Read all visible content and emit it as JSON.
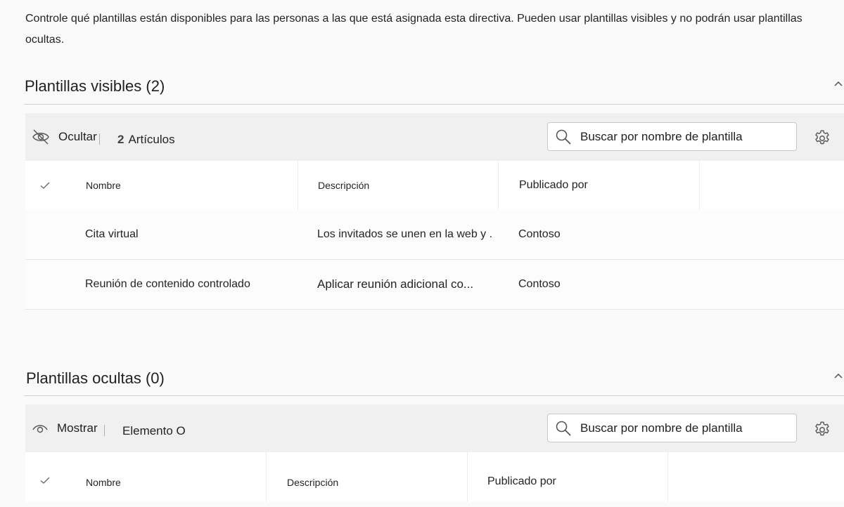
{
  "intro_text": "Controle qué plantillas están disponibles para las personas a las que está asignada esta directiva. Pueden usar plantillas visibles y no podrán usar plantillas ocultas.",
  "visible_section": {
    "title": "Plantillas visibles (2)",
    "action_label": "Ocultar",
    "count_number": "2",
    "count_label": "Artículos",
    "search_placeholder": "Buscar por nombre de plantilla",
    "columns": [
      "Nombre",
      "Descripción",
      "Publicado por"
    ],
    "rows": [
      {
        "name": "Cita virtual",
        "description": "Los invitados se unen en la web y .",
        "publisher": "Contoso"
      },
      {
        "name": "Reunión de contenido controlado",
        "description": "Aplicar reunión adicional co...",
        "publisher": "Contoso"
      }
    ]
  },
  "hidden_section": {
    "title": "Plantillas ocultas (0)",
    "action_label": "Mostrar",
    "count_label": "Elemento O",
    "search_placeholder": "Buscar por nombre de plantilla",
    "columns": [
      "Nombre",
      "Descripción",
      "Publicado por"
    ]
  }
}
